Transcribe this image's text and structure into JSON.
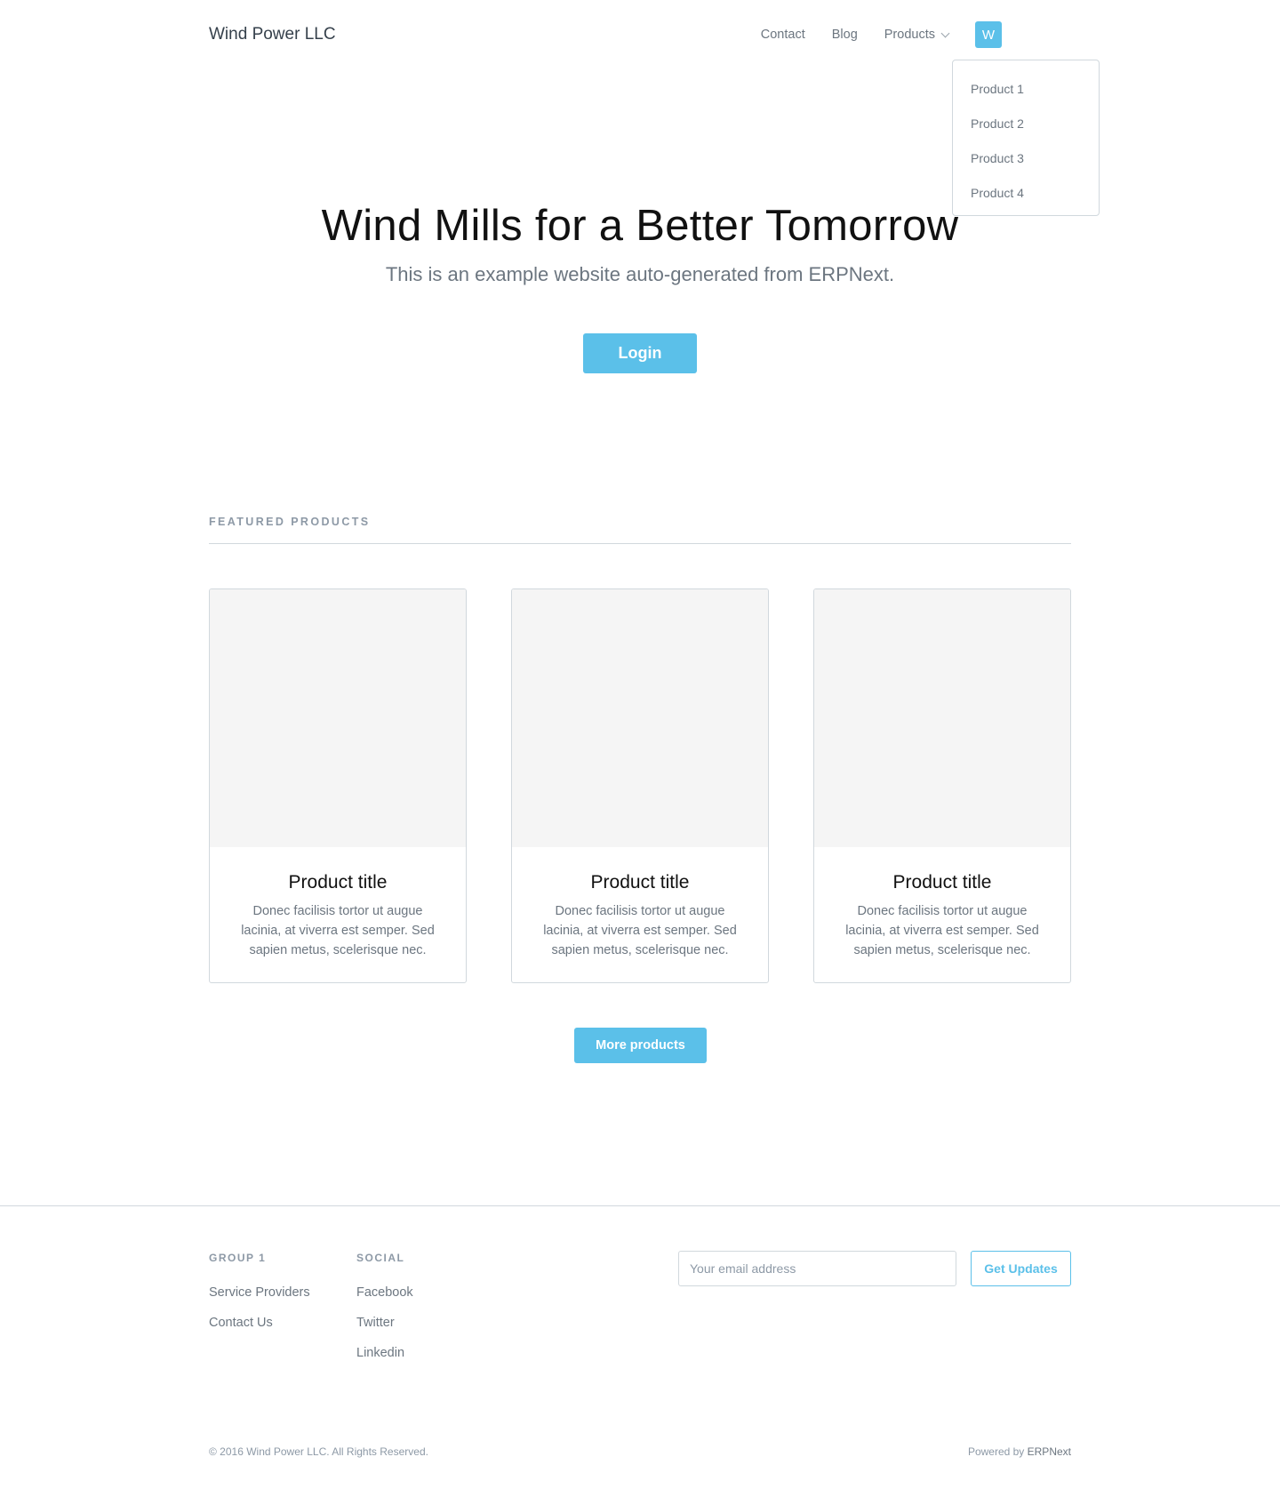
{
  "navbar": {
    "brand": "Wind Power LLC",
    "links": [
      "Contact",
      "Blog"
    ],
    "products_label": "Products",
    "avatar_letter": "W",
    "dropdown": [
      "Product 1",
      "Product 2",
      "Product 3",
      "Product 4"
    ]
  },
  "hero": {
    "title": "Wind Mills for a Better Tomorrow",
    "subtitle": "This is an example website auto-generated from ERPNext.",
    "login_label": "Login"
  },
  "featured": {
    "label": "FEATURED PRODUCTS",
    "cards": [
      {
        "title": "Product title",
        "text": "Donec facilisis tortor ut augue lacinia, at viverra est semper. Sed sapien metus, scelerisque nec."
      },
      {
        "title": "Product title",
        "text": "Donec facilisis tortor ut augue lacinia, at viverra est semper. Sed sapien metus, scelerisque nec."
      },
      {
        "title": "Product title",
        "text": "Donec facilisis tortor ut augue lacinia, at viverra est semper. Sed sapien metus, scelerisque nec."
      }
    ],
    "more_label": "More products"
  },
  "footer": {
    "groups": [
      {
        "title": "GROUP 1",
        "links": [
          "Service Providers",
          "Contact Us"
        ]
      },
      {
        "title": "SOCIAL",
        "links": [
          "Facebook",
          "Twitter",
          "Linkedin"
        ]
      }
    ],
    "email_placeholder": "Your email address",
    "updates_label": "Get Updates",
    "copyright": "© 2016 Wind Power LLC. All Rights Reserved.",
    "powered_prefix": "Powered by ",
    "powered_link": "ERPNext"
  },
  "colors": {
    "accent": "#5bc0e9",
    "text": "#36414c",
    "muted": "#6c7680",
    "border": "#d1d8dd",
    "placeholder_bg": "#f5f5f5"
  }
}
